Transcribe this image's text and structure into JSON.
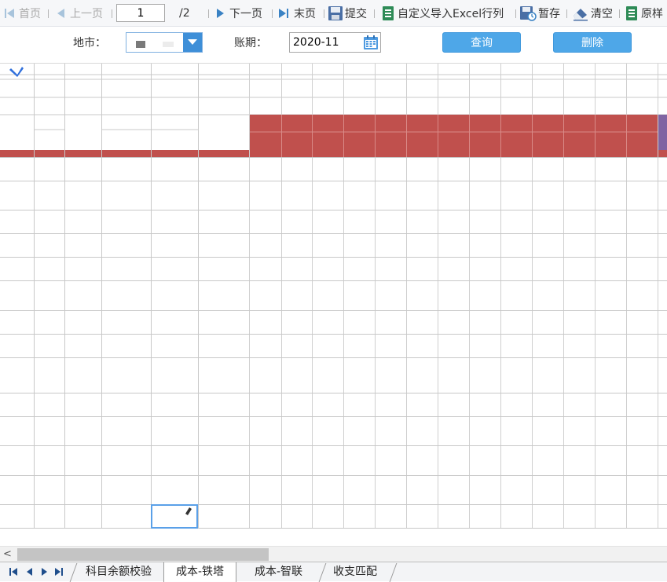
{
  "toolbar": {
    "first_label": "首页",
    "prev_label": "上一页",
    "current_page": "1",
    "total_pages": "/2",
    "next_label": "下一页",
    "last_label": "末页",
    "submit_label": "提交",
    "import_label": "自定义导入Excel行列",
    "draft_label": "暂存",
    "clear_label": "清空",
    "original_label": "原样"
  },
  "filters": {
    "city_label": "地市：",
    "period_label": "账期：",
    "period_value": "2020-11",
    "query_label": "查询",
    "delete_label": "删除"
  },
  "colors": {
    "header_red": "#c0504d",
    "header_purple": "#8064a2",
    "button_blue": "#4ea7e8",
    "select_blue": "#3e8fd8"
  },
  "tabs": {
    "items": [
      "科目余额校验",
      "成本-铁塔",
      "成本-智联",
      "收支匹配"
    ],
    "active": 1
  }
}
